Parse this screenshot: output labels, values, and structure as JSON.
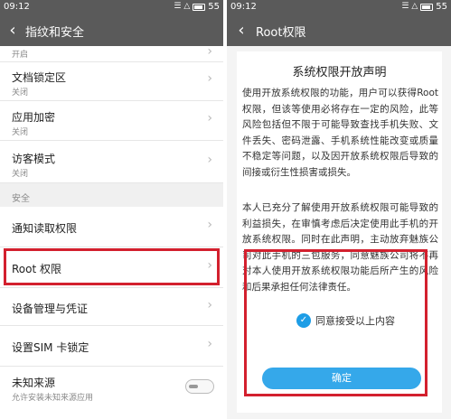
{
  "left_screen": {
    "status": {
      "time": "09:12",
      "signal_glyphs": "☰ △",
      "battery": "55"
    },
    "title": "指纹和安全",
    "top_partial_sub": "开启",
    "items": [
      {
        "label": "文档锁定区",
        "sub": "关闭"
      },
      {
        "label": "应用加密",
        "sub": "关闭"
      },
      {
        "label": "访客模式",
        "sub": "关闭"
      }
    ],
    "section_header": "安全",
    "security_items": [
      {
        "label": "通知读取权限"
      },
      {
        "label": "Root 权限"
      },
      {
        "label": "设备管理与凭证"
      },
      {
        "label": "设置SIM 卡锁定"
      }
    ],
    "unknown_sources": {
      "label": "未知来源",
      "sub": "允许安装未知来源应用",
      "enabled": false
    }
  },
  "right_screen": {
    "status": {
      "time": "09:12",
      "signal_glyphs": "☰ △",
      "battery": "55"
    },
    "title": "Root权限",
    "dialog": {
      "title": "系统权限开放声明",
      "paragraph1": "使用开放系统权限的功能，用户可以获得Root权限，但该等使用必将存在一定的风险，此等风险包括但不限于可能导致查找手机失败、文件丢失、密码泄露、手机系统性能改变或质量不稳定等问题，以及因开放系统权限后导致的间接或衍生性损害或损失。",
      "paragraph2": "本人已充分了解使用开放系统权限可能导致的利益损失，在审慎考虑后决定使用此手机的开放系统权限。同时在此声明，主动放弃魅族公司对此手机的三包服务，同意魅族公司将不再对本人使用开放系统权限功能后所产生的风险和后果承担任何法律责任。",
      "agree_label": "同意接受以上内容",
      "agree_checked": true,
      "confirm_label": "确定"
    }
  },
  "colors": {
    "bar": "#5a5a5a",
    "highlight": "#d3202e",
    "accent": "#35a8ea"
  }
}
